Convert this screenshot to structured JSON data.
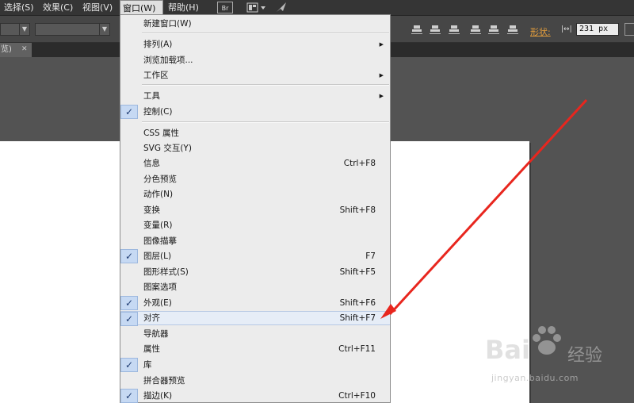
{
  "menubar": {
    "items": [
      "选择(S)",
      "效果(C)",
      "视图(V)",
      "窗口(W)",
      "帮助(H)"
    ],
    "bridge_label": "Br"
  },
  "control_bar": {
    "shape_label": "形状:",
    "width_value": "231 px"
  },
  "document_tab": {
    "label": "览)"
  },
  "window_menu": {
    "items": [
      {
        "label": "新建窗口(W)",
        "shortcut": "",
        "checked": false,
        "submenu": false
      },
      {
        "label": "排列(A)",
        "shortcut": "",
        "checked": false,
        "submenu": true
      },
      {
        "label": "浏览加载项...",
        "shortcut": "",
        "checked": false,
        "submenu": false
      },
      {
        "label": "工作区",
        "shortcut": "",
        "checked": false,
        "submenu": true
      },
      {
        "label": "工具",
        "shortcut": "",
        "checked": false,
        "submenu": true
      },
      {
        "label": "控制(C)",
        "shortcut": "",
        "checked": true,
        "submenu": false
      },
      {
        "label": "CSS 属性",
        "shortcut": "",
        "checked": false,
        "submenu": false
      },
      {
        "label": "SVG 交互(Y)",
        "shortcut": "",
        "checked": false,
        "submenu": false
      },
      {
        "label": "信息",
        "shortcut": "Ctrl+F8",
        "checked": false,
        "submenu": false
      },
      {
        "label": "分色预览",
        "shortcut": "",
        "checked": false,
        "submenu": false
      },
      {
        "label": "动作(N)",
        "shortcut": "",
        "checked": false,
        "submenu": false
      },
      {
        "label": "变换",
        "shortcut": "Shift+F8",
        "checked": false,
        "submenu": false
      },
      {
        "label": "变量(R)",
        "shortcut": "",
        "checked": false,
        "submenu": false
      },
      {
        "label": "图像描摹",
        "shortcut": "",
        "checked": false,
        "submenu": false
      },
      {
        "label": "图层(L)",
        "shortcut": "F7",
        "checked": true,
        "submenu": false
      },
      {
        "label": "图形样式(S)",
        "shortcut": "Shift+F5",
        "checked": false,
        "submenu": false
      },
      {
        "label": "图案选项",
        "shortcut": "",
        "checked": false,
        "submenu": false
      },
      {
        "label": "外观(E)",
        "shortcut": "Shift+F6",
        "checked": true,
        "submenu": false
      },
      {
        "label": "对齐",
        "shortcut": "Shift+F7",
        "checked": true,
        "submenu": false,
        "highlighted": true
      },
      {
        "label": "导航器",
        "shortcut": "",
        "checked": false,
        "submenu": false
      },
      {
        "label": "属性",
        "shortcut": "Ctrl+F11",
        "checked": false,
        "submenu": false
      },
      {
        "label": "库",
        "shortcut": "",
        "checked": true,
        "submenu": false
      },
      {
        "label": "拼合器预览",
        "shortcut": "",
        "checked": false,
        "submenu": false
      },
      {
        "label": "描边(K)",
        "shortcut": "Ctrl+F10",
        "checked": true,
        "submenu": false
      }
    ]
  },
  "annotation": {
    "arrow_color": "#e8261e"
  },
  "watermark": {
    "logo": "Bai",
    "brand": "经验",
    "url": "jingyan.baidu.com"
  },
  "colors": {
    "menubar_bg": "#353535",
    "menu_bg": "#ececec",
    "check_bg": "#c6d9f3",
    "highlight": "#e6edf7",
    "accent_orange": "#e8a03c"
  }
}
